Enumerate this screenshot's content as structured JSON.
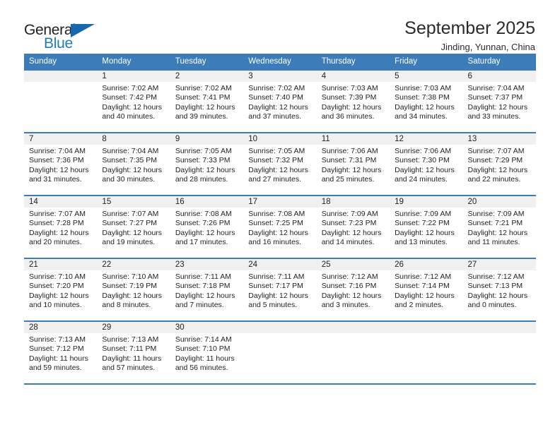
{
  "brand": {
    "name_top": "General",
    "name_bottom": "Blue",
    "accent_color": "#1668ad",
    "text_color": "#231f20",
    "triangle_icon": "triangle-icon"
  },
  "header": {
    "title": "September 2025",
    "subtitle": "Jinding, Yunnan, China"
  },
  "calendar": {
    "header_bg": "#3b7cb9",
    "daynum_bg": "#f0f0f0",
    "weekdays": [
      "Sunday",
      "Monday",
      "Tuesday",
      "Wednesday",
      "Thursday",
      "Friday",
      "Saturday"
    ],
    "weeks": [
      [
        {
          "day": "",
          "sunrise": "",
          "sunset": "",
          "daylight_1": "",
          "daylight_2": ""
        },
        {
          "day": "1",
          "sunrise": "Sunrise: 7:02 AM",
          "sunset": "Sunset: 7:42 PM",
          "daylight_1": "Daylight: 12 hours",
          "daylight_2": "and 40 minutes."
        },
        {
          "day": "2",
          "sunrise": "Sunrise: 7:02 AM",
          "sunset": "Sunset: 7:41 PM",
          "daylight_1": "Daylight: 12 hours",
          "daylight_2": "and 39 minutes."
        },
        {
          "day": "3",
          "sunrise": "Sunrise: 7:02 AM",
          "sunset": "Sunset: 7:40 PM",
          "daylight_1": "Daylight: 12 hours",
          "daylight_2": "and 37 minutes."
        },
        {
          "day": "4",
          "sunrise": "Sunrise: 7:03 AM",
          "sunset": "Sunset: 7:39 PM",
          "daylight_1": "Daylight: 12 hours",
          "daylight_2": "and 36 minutes."
        },
        {
          "day": "5",
          "sunrise": "Sunrise: 7:03 AM",
          "sunset": "Sunset: 7:38 PM",
          "daylight_1": "Daylight: 12 hours",
          "daylight_2": "and 34 minutes."
        },
        {
          "day": "6",
          "sunrise": "Sunrise: 7:04 AM",
          "sunset": "Sunset: 7:37 PM",
          "daylight_1": "Daylight: 12 hours",
          "daylight_2": "and 33 minutes."
        }
      ],
      [
        {
          "day": "7",
          "sunrise": "Sunrise: 7:04 AM",
          "sunset": "Sunset: 7:36 PM",
          "daylight_1": "Daylight: 12 hours",
          "daylight_2": "and 31 minutes."
        },
        {
          "day": "8",
          "sunrise": "Sunrise: 7:04 AM",
          "sunset": "Sunset: 7:35 PM",
          "daylight_1": "Daylight: 12 hours",
          "daylight_2": "and 30 minutes."
        },
        {
          "day": "9",
          "sunrise": "Sunrise: 7:05 AM",
          "sunset": "Sunset: 7:33 PM",
          "daylight_1": "Daylight: 12 hours",
          "daylight_2": "and 28 minutes."
        },
        {
          "day": "10",
          "sunrise": "Sunrise: 7:05 AM",
          "sunset": "Sunset: 7:32 PM",
          "daylight_1": "Daylight: 12 hours",
          "daylight_2": "and 27 minutes."
        },
        {
          "day": "11",
          "sunrise": "Sunrise: 7:06 AM",
          "sunset": "Sunset: 7:31 PM",
          "daylight_1": "Daylight: 12 hours",
          "daylight_2": "and 25 minutes."
        },
        {
          "day": "12",
          "sunrise": "Sunrise: 7:06 AM",
          "sunset": "Sunset: 7:30 PM",
          "daylight_1": "Daylight: 12 hours",
          "daylight_2": "and 24 minutes."
        },
        {
          "day": "13",
          "sunrise": "Sunrise: 7:07 AM",
          "sunset": "Sunset: 7:29 PM",
          "daylight_1": "Daylight: 12 hours",
          "daylight_2": "and 22 minutes."
        }
      ],
      [
        {
          "day": "14",
          "sunrise": "Sunrise: 7:07 AM",
          "sunset": "Sunset: 7:28 PM",
          "daylight_1": "Daylight: 12 hours",
          "daylight_2": "and 20 minutes."
        },
        {
          "day": "15",
          "sunrise": "Sunrise: 7:07 AM",
          "sunset": "Sunset: 7:27 PM",
          "daylight_1": "Daylight: 12 hours",
          "daylight_2": "and 19 minutes."
        },
        {
          "day": "16",
          "sunrise": "Sunrise: 7:08 AM",
          "sunset": "Sunset: 7:26 PM",
          "daylight_1": "Daylight: 12 hours",
          "daylight_2": "and 17 minutes."
        },
        {
          "day": "17",
          "sunrise": "Sunrise: 7:08 AM",
          "sunset": "Sunset: 7:25 PM",
          "daylight_1": "Daylight: 12 hours",
          "daylight_2": "and 16 minutes."
        },
        {
          "day": "18",
          "sunrise": "Sunrise: 7:09 AM",
          "sunset": "Sunset: 7:23 PM",
          "daylight_1": "Daylight: 12 hours",
          "daylight_2": "and 14 minutes."
        },
        {
          "day": "19",
          "sunrise": "Sunrise: 7:09 AM",
          "sunset": "Sunset: 7:22 PM",
          "daylight_1": "Daylight: 12 hours",
          "daylight_2": "and 13 minutes."
        },
        {
          "day": "20",
          "sunrise": "Sunrise: 7:09 AM",
          "sunset": "Sunset: 7:21 PM",
          "daylight_1": "Daylight: 12 hours",
          "daylight_2": "and 11 minutes."
        }
      ],
      [
        {
          "day": "21",
          "sunrise": "Sunrise: 7:10 AM",
          "sunset": "Sunset: 7:20 PM",
          "daylight_1": "Daylight: 12 hours",
          "daylight_2": "and 10 minutes."
        },
        {
          "day": "22",
          "sunrise": "Sunrise: 7:10 AM",
          "sunset": "Sunset: 7:19 PM",
          "daylight_1": "Daylight: 12 hours",
          "daylight_2": "and 8 minutes."
        },
        {
          "day": "23",
          "sunrise": "Sunrise: 7:11 AM",
          "sunset": "Sunset: 7:18 PM",
          "daylight_1": "Daylight: 12 hours",
          "daylight_2": "and 7 minutes."
        },
        {
          "day": "24",
          "sunrise": "Sunrise: 7:11 AM",
          "sunset": "Sunset: 7:17 PM",
          "daylight_1": "Daylight: 12 hours",
          "daylight_2": "and 5 minutes."
        },
        {
          "day": "25",
          "sunrise": "Sunrise: 7:12 AM",
          "sunset": "Sunset: 7:16 PM",
          "daylight_1": "Daylight: 12 hours",
          "daylight_2": "and 3 minutes."
        },
        {
          "day": "26",
          "sunrise": "Sunrise: 7:12 AM",
          "sunset": "Sunset: 7:14 PM",
          "daylight_1": "Daylight: 12 hours",
          "daylight_2": "and 2 minutes."
        },
        {
          "day": "27",
          "sunrise": "Sunrise: 7:12 AM",
          "sunset": "Sunset: 7:13 PM",
          "daylight_1": "Daylight: 12 hours",
          "daylight_2": "and 0 minutes."
        }
      ],
      [
        {
          "day": "28",
          "sunrise": "Sunrise: 7:13 AM",
          "sunset": "Sunset: 7:12 PM",
          "daylight_1": "Daylight: 11 hours",
          "daylight_2": "and 59 minutes."
        },
        {
          "day": "29",
          "sunrise": "Sunrise: 7:13 AM",
          "sunset": "Sunset: 7:11 PM",
          "daylight_1": "Daylight: 11 hours",
          "daylight_2": "and 57 minutes."
        },
        {
          "day": "30",
          "sunrise": "Sunrise: 7:14 AM",
          "sunset": "Sunset: 7:10 PM",
          "daylight_1": "Daylight: 11 hours",
          "daylight_2": "and 56 minutes."
        },
        {
          "day": "",
          "sunrise": "",
          "sunset": "",
          "daylight_1": "",
          "daylight_2": ""
        },
        {
          "day": "",
          "sunrise": "",
          "sunset": "",
          "daylight_1": "",
          "daylight_2": ""
        },
        {
          "day": "",
          "sunrise": "",
          "sunset": "",
          "daylight_1": "",
          "daylight_2": ""
        },
        {
          "day": "",
          "sunrise": "",
          "sunset": "",
          "daylight_1": "",
          "daylight_2": ""
        }
      ]
    ]
  }
}
